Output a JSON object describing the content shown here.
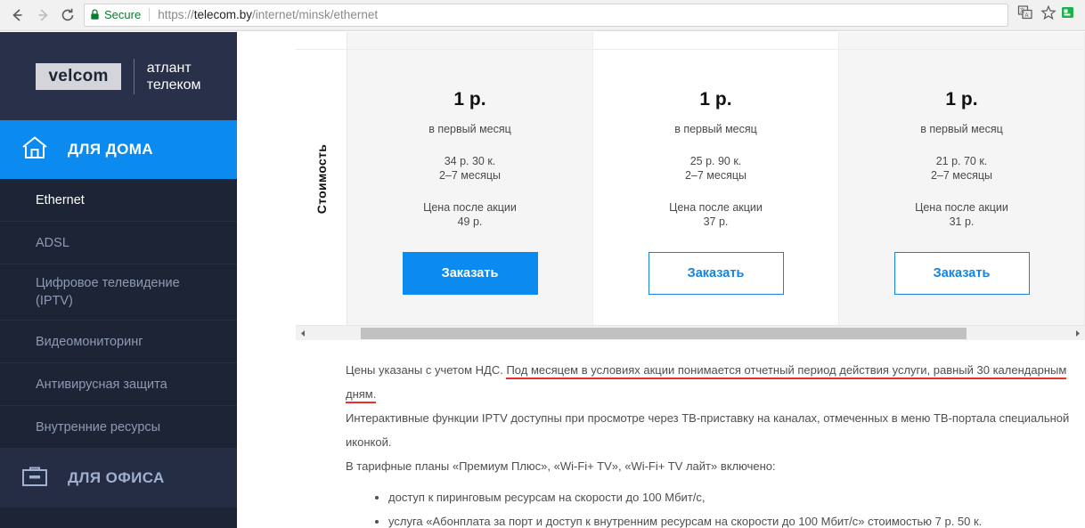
{
  "browser": {
    "back_icon": "back-arrow-icon",
    "forward_icon": "forward-arrow-icon",
    "reload_icon": "reload-icon",
    "lock_icon": "lock-icon",
    "secure_label": "Secure",
    "url_scheme": "https://",
    "url_domain": "telecom.by",
    "url_path": "/internet/minsk/ethernet",
    "translate_icon": "translate-icon",
    "bookmark_icon": "star-icon",
    "extension_icon": "extension-icon",
    "accent_secure_color": "#0b7a34"
  },
  "sidebar": {
    "logo": {
      "mark": "velcom",
      "text_line1": "атлант",
      "text_line2": "телеком"
    },
    "primary_nav": {
      "label": "ДЛЯ ДОМА",
      "icon": "home-icon",
      "active_color": "#0b8af0"
    },
    "items": [
      {
        "label": "Ethernet",
        "active": true
      },
      {
        "label": "ADSL",
        "active": false
      },
      {
        "label": "Цифровое телевидение (IPTV)",
        "active": false
      },
      {
        "label": "Видеомониторинг",
        "active": false
      },
      {
        "label": "Антивирусная защита",
        "active": false
      },
      {
        "label": "Внутренние ресурсы",
        "active": false
      }
    ],
    "office_nav": {
      "label": "ДЛЯ ОФИСА",
      "icon": "briefcase-icon"
    }
  },
  "table": {
    "row_label": "Стоимость",
    "columns": [
      {
        "price_main": "1 р.",
        "price_sub": "в первый месяц",
        "mid_price": "34 р. 30 к.",
        "mid_period": "2–7 месяцы",
        "after_label": "Цена после акции",
        "after_price": "49 р.",
        "button_label": "Заказать",
        "button_style": "filled",
        "shaded": true
      },
      {
        "price_main": "1 р.",
        "price_sub": "в первый месяц",
        "mid_price": "25 р. 90 к.",
        "mid_period": "2–7 месяцы",
        "after_label": "Цена после акции",
        "after_price": "37 р.",
        "button_label": "Заказать",
        "button_style": "outline",
        "shaded": false
      },
      {
        "price_main": "1 р.",
        "price_sub": "в первый месяц",
        "mid_price": "21 р. 70 к.",
        "mid_period": "2–7 месяцы",
        "after_label": "Цена после акции",
        "after_price": "31 р.",
        "button_label": "Заказать",
        "button_style": "outline",
        "shaded": true
      }
    ],
    "scrollbar": {
      "left_arrow_icon": "scroll-left-arrow-icon",
      "right_arrow_icon": "scroll-right-arrow-icon"
    }
  },
  "notes": {
    "line1_plain": "Цены указаны с учетом НДС. ",
    "line1_underlined": "Под месяцем в условиях акции понимается отчетный период действия услуги, равный 30 календарным дням.",
    "line2": "Интерактивные функции IPTV доступны при просмотре через ТВ-приставку на каналах, отмеченных в меню ТВ-портала специальной иконкой.",
    "line3": "В тарифные планы «Премиум Плюс», «Wi-Fi+ TV», «Wi-Fi+ TV лайт» включено:",
    "bullets": [
      "доступ к пиринговым ресурсам на скорости до 100 Мбит/с,",
      "услуга «Абонплата за порт и доступ к внутренним ресурсам на скорости до 100 Мбит/с» стоимостью 7 р. 50 к."
    ],
    "underline_color": "#e8312f"
  }
}
